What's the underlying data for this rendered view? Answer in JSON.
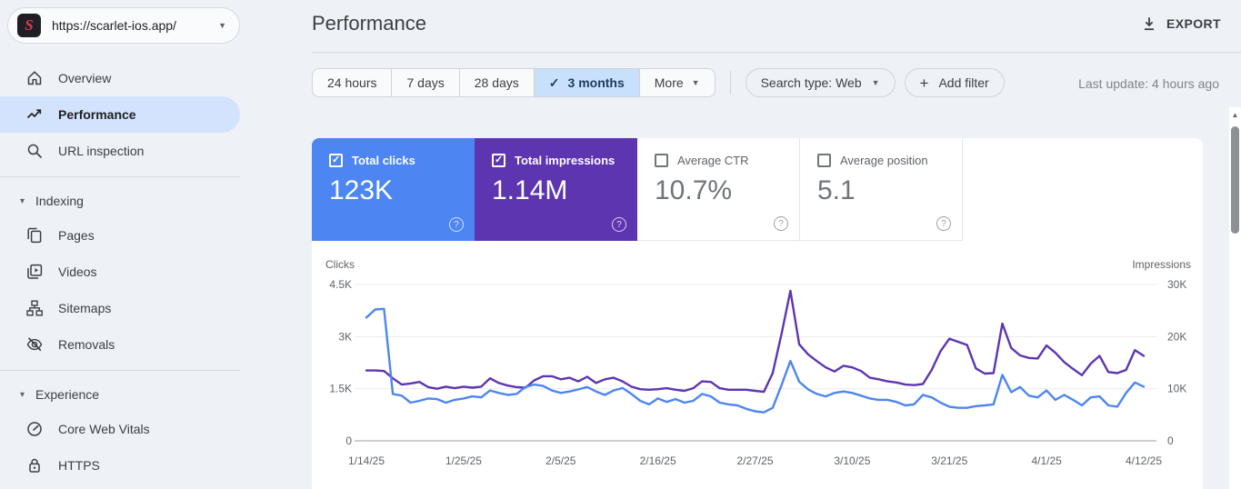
{
  "icons": {
    "check": "✓",
    "chevron_down": "▾",
    "dropdown": "▼",
    "plus": "+",
    "scroll_up": "▲",
    "help": "?"
  },
  "sidebar": {
    "property": {
      "url": "https://scarlet-ios.app/",
      "logo_letter": "S"
    },
    "items": [
      {
        "label": "Overview",
        "icon": "home",
        "selected": false
      },
      {
        "label": "Performance",
        "icon": "trending-up",
        "selected": true
      },
      {
        "label": "URL inspection",
        "icon": "search",
        "selected": false
      }
    ],
    "sections": [
      {
        "label": "Indexing",
        "items": [
          {
            "label": "Pages",
            "icon": "pages"
          },
          {
            "label": "Videos",
            "icon": "video-library"
          },
          {
            "label": "Sitemaps",
            "icon": "sitemap-tree"
          },
          {
            "label": "Removals",
            "icon": "visibility-off"
          }
        ]
      },
      {
        "label": "Experience",
        "items": [
          {
            "label": "Core Web Vitals",
            "icon": "speedometer"
          },
          {
            "label": "HTTPS",
            "icon": "lock"
          }
        ]
      }
    ]
  },
  "header": {
    "title": "Performance",
    "export_label": "EXPORT"
  },
  "filter_bar": {
    "date_ranges": [
      "24 hours",
      "7 days",
      "28 days",
      "3 months"
    ],
    "selected_range": "3 months",
    "more_label": "More",
    "search_type_label": "Search type: Web",
    "add_filter_label": "Add filter",
    "last_update": "Last update: 4 hours ago"
  },
  "metrics": [
    {
      "label": "Total clicks",
      "value": "123K",
      "checked": true,
      "color": "#4d86f2"
    },
    {
      "label": "Total impressions",
      "value": "1.14M",
      "checked": true,
      "color": "#5e35b1"
    },
    {
      "label": "Average CTR",
      "value": "10.7%",
      "checked": false,
      "color": "#ffffff"
    },
    {
      "label": "Average position",
      "value": "5.1",
      "checked": false,
      "color": "#ffffff"
    }
  ],
  "chart_data": {
    "type": "line",
    "grid": "horizontal",
    "legend": "none",
    "x_tick_labels": [
      "1/14/25",
      "1/25/25",
      "2/5/25",
      "2/16/25",
      "2/27/25",
      "3/10/25",
      "3/21/25",
      "4/1/25",
      "4/12/25"
    ],
    "left_axis": {
      "label": "Clicks",
      "max": 4.5,
      "ticks": [
        {
          "v": 0,
          "t": "0"
        },
        {
          "v": 1.5,
          "t": "1.5K"
        },
        {
          "v": 3,
          "t": "3K"
        },
        {
          "v": 4.5,
          "t": "4.5K"
        }
      ]
    },
    "right_axis": {
      "label": "Impressions",
      "max": 30,
      "ticks": [
        {
          "v": 0,
          "t": "0"
        },
        {
          "v": 10,
          "t": "10K"
        },
        {
          "v": 20,
          "t": "20K"
        },
        {
          "v": 30,
          "t": "30K"
        }
      ]
    },
    "series": [
      {
        "name": "Total clicks",
        "axis": "left",
        "color": "#4d86f2",
        "unit": "thousands",
        "values": [
          3.55,
          3.78,
          3.8,
          1.35,
          1.3,
          1.1,
          1.15,
          1.22,
          1.2,
          1.1,
          1.18,
          1.22,
          1.28,
          1.25,
          1.45,
          1.38,
          1.32,
          1.35,
          1.55,
          1.62,
          1.58,
          1.45,
          1.38,
          1.42,
          1.48,
          1.55,
          1.42,
          1.32,
          1.45,
          1.52,
          1.35,
          1.15,
          1.05,
          1.22,
          1.12,
          1.2,
          1.1,
          1.15,
          1.35,
          1.28,
          1.1,
          1.05,
          1.02,
          0.92,
          0.85,
          0.82,
          0.95,
          1.6,
          2.3,
          1.7,
          1.48,
          1.35,
          1.28,
          1.38,
          1.42,
          1.38,
          1.3,
          1.22,
          1.18,
          1.18,
          1.12,
          1.02,
          1.05,
          1.32,
          1.25,
          1.1,
          0.98,
          0.95,
          0.95,
          1.0,
          1.02,
          1.05,
          1.9,
          1.4,
          1.55,
          1.3,
          1.25,
          1.45,
          1.18,
          1.32,
          1.18,
          1.02,
          1.25,
          1.28,
          1.02,
          0.98,
          1.38,
          1.68,
          1.56
        ]
      },
      {
        "name": "Total impressions",
        "axis": "right",
        "color": "#5e35b1",
        "unit": "thousands",
        "values": [
          13.5,
          13.5,
          13.4,
          12.0,
          10.8,
          11.0,
          11.3,
          10.3,
          10.0,
          10.4,
          10.1,
          10.4,
          10.2,
          10.4,
          12.0,
          11.1,
          10.6,
          10.3,
          10.2,
          11.6,
          12.4,
          12.4,
          11.8,
          12.1,
          11.4,
          12.3,
          11.1,
          11.8,
          12.1,
          11.4,
          10.4,
          9.9,
          9.8,
          9.9,
          10.1,
          9.8,
          9.6,
          10.1,
          11.4,
          11.3,
          10.1,
          9.8,
          9.8,
          9.8,
          9.6,
          9.4,
          13.0,
          20.5,
          28.8,
          18.5,
          16.6,
          15.3,
          14.1,
          13.3,
          14.4,
          14.1,
          13.4,
          12.1,
          11.8,
          11.4,
          11.2,
          10.8,
          10.7,
          10.9,
          13.6,
          17.2,
          19.6,
          19.0,
          18.4,
          13.9,
          12.9,
          13.0,
          22.5,
          17.8,
          16.4,
          15.9,
          15.8,
          18.3,
          16.9,
          15.1,
          13.8,
          12.6,
          14.8,
          16.3,
          13.2,
          13.0,
          13.6,
          17.4,
          16.3
        ]
      }
    ]
  }
}
